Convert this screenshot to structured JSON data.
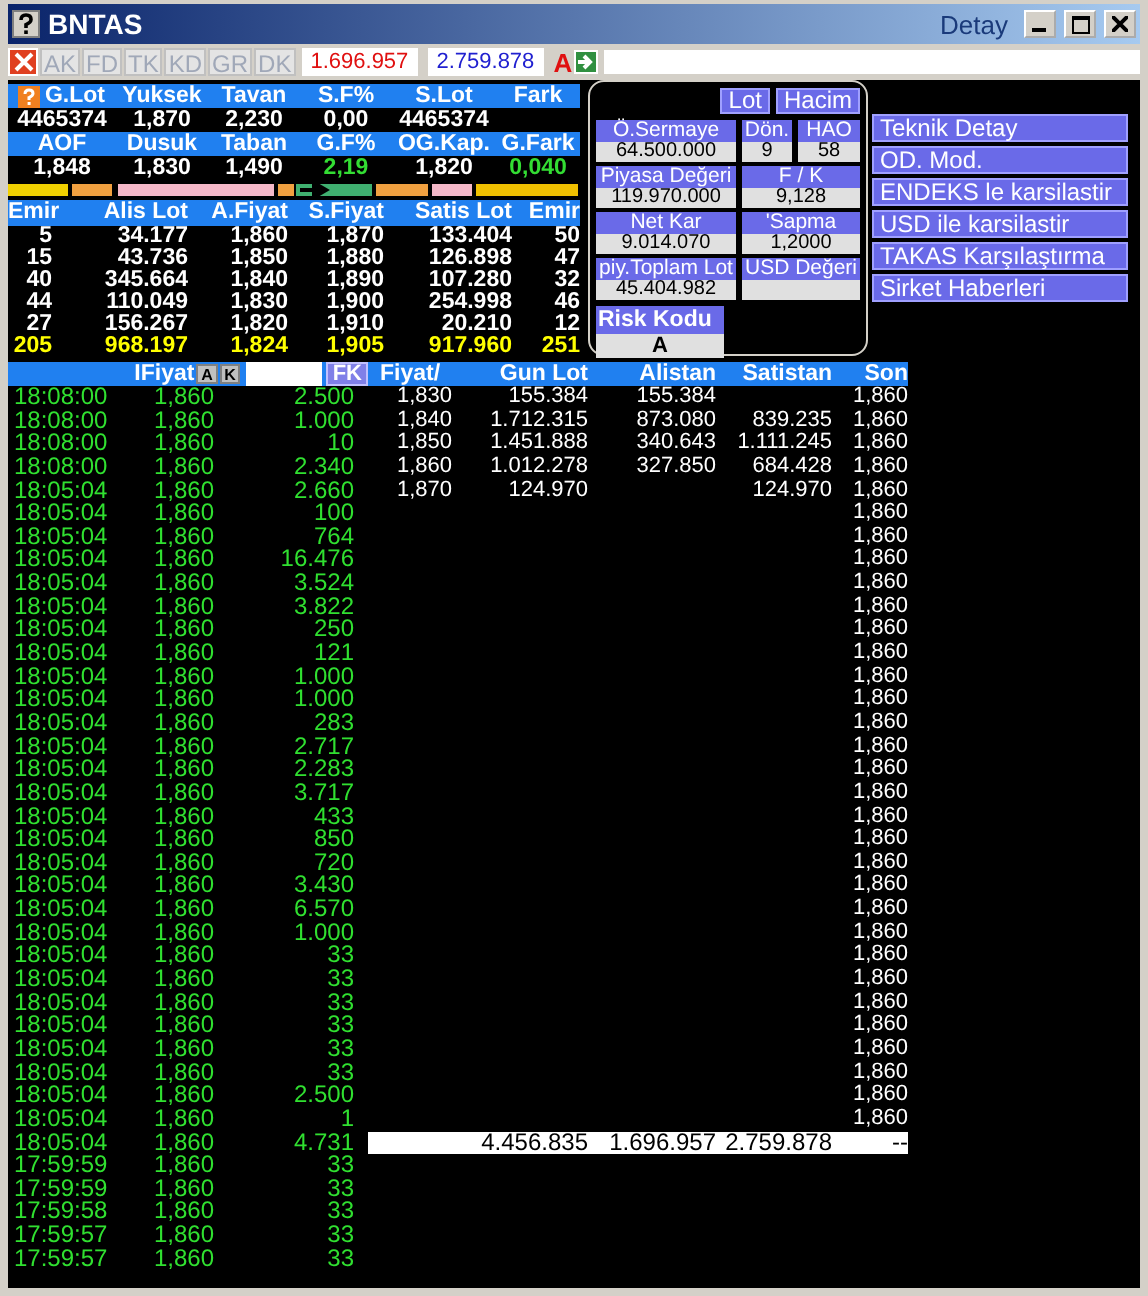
{
  "window": {
    "title": "BNTAS",
    "subtitle": "Detay"
  },
  "toolbar": {
    "buttons": [
      {
        "label": "AK",
        "disabled": true
      },
      {
        "label": "FD",
        "disabled": true
      },
      {
        "label": "TK",
        "disabled": true
      },
      {
        "label": "KD",
        "disabled": true
      },
      {
        "label": "GR",
        "disabled": true
      },
      {
        "label": "DK",
        "disabled": true
      }
    ],
    "sell_total": "1.696.957",
    "buy_total": "2.759.878",
    "flag": "A"
  },
  "stats": [
    {
      "items": [
        {
          "label": "G.Lot",
          "value": "4465374",
          "rising": false
        },
        {
          "label": "Yuksek",
          "value": "1,870",
          "rising": false
        },
        {
          "label": "Tavan",
          "value": "2,230",
          "rising": false
        },
        {
          "label": "S.F%",
          "value": "0,00",
          "rising": false
        },
        {
          "label": "S.Lot",
          "value": "4465374",
          "rising": false
        },
        {
          "label": "Fark"
        }
      ]
    },
    {
      "items": [
        {
          "label": "AOF",
          "value": "1,848",
          "rising": false
        },
        {
          "label": "Dusuk",
          "value": "1,830",
          "rising": false
        },
        {
          "label": "Taban",
          "value": "1,490",
          "rising": false
        },
        {
          "label": "G.F%",
          "value": "2,19",
          "rising": true
        },
        {
          "label": "OG.Kap.",
          "value": "1,820",
          "rising": false
        },
        {
          "label": "G.Fark",
          "value": "0,040",
          "rising": true
        }
      ]
    }
  ],
  "order_book": {
    "columns": [
      "Emir",
      "Alis Lot",
      "A.Fiyat",
      "S.Fiyat",
      "Satis Lot",
      "Emir"
    ],
    "rows": [
      [
        "5",
        "34.177",
        "1,860",
        "1,870",
        "133.404",
        "50"
      ],
      [
        "15",
        "43.736",
        "1,850",
        "1,880",
        "126.898",
        "47"
      ],
      [
        "40",
        "345.664",
        "1,840",
        "1,890",
        "107.280",
        "32"
      ],
      [
        "44",
        "110.049",
        "1,830",
        "1,900",
        "254.998",
        "46"
      ],
      [
        "27",
        "156.267",
        "1,820",
        "1,910",
        "20.210",
        "12"
      ]
    ],
    "totals": [
      "205",
      "968.197",
      "1,824",
      "1,905",
      "917.960",
      "251"
    ]
  },
  "info_panel": {
    "buttons": [
      "Lot",
      "Hacim"
    ],
    "fields": [
      {
        "label": "Ö.Sermaye",
        "value": "64.500.000"
      },
      {
        "label": "Dön.",
        "value": "9"
      },
      {
        "label": "HAO",
        "value": "58"
      },
      {
        "label": "Piyasa Değeri",
        "value": "119.970.000"
      },
      {
        "label": "F / K",
        "value": "9,128"
      },
      {
        "label": "Net Kar",
        "value": "9.014.070"
      },
      {
        "label": "'Sapma",
        "value": "1,2000"
      },
      {
        "label": "piy.Toplam Lot",
        "value": "45.404.982"
      },
      {
        "label": "USD Değeri"
      }
    ],
    "risk": {
      "label": "Risk Kodu",
      "value": "A"
    }
  },
  "links": [
    "Teknik Detay",
    "OD. Mod.",
    "ENDEKS le karsilastir",
    "USD ile karsilastir",
    "TAKAS Karşılaştırma",
    "Sirket Haberleri"
  ],
  "trades": {
    "column": "IFiyat",
    "filter_buttons": [
      "A",
      "K"
    ],
    "fk_button": "FK",
    "rows": [
      {
        "time": "18:08:00",
        "price": "1,860",
        "lot": "2.500"
      },
      {
        "time": "18:08:00",
        "price": "1,860",
        "lot": "1.000"
      },
      {
        "time": "18:08:00",
        "price": "1,860",
        "lot": "10"
      },
      {
        "time": "18:08:00",
        "price": "1,860",
        "lot": "2.340"
      },
      {
        "time": "18:05:04",
        "price": "1,860",
        "lot": "2.660"
      },
      {
        "time": "18:05:04",
        "price": "1,860",
        "lot": "100"
      },
      {
        "time": "18:05:04",
        "price": "1,860",
        "lot": "764"
      },
      {
        "time": "18:05:04",
        "price": "1,860",
        "lot": "16.476"
      },
      {
        "time": "18:05:04",
        "price": "1,860",
        "lot": "3.524"
      },
      {
        "time": "18:05:04",
        "price": "1,860",
        "lot": "3.822"
      },
      {
        "time": "18:05:04",
        "price": "1,860",
        "lot": "250"
      },
      {
        "time": "18:05:04",
        "price": "1,860",
        "lot": "121"
      },
      {
        "time": "18:05:04",
        "price": "1,860",
        "lot": "1.000"
      },
      {
        "time": "18:05:04",
        "price": "1,860",
        "lot": "1.000"
      },
      {
        "time": "18:05:04",
        "price": "1,860",
        "lot": "283"
      },
      {
        "time": "18:05:04",
        "price": "1,860",
        "lot": "2.717"
      },
      {
        "time": "18:05:04",
        "price": "1,860",
        "lot": "2.283"
      },
      {
        "time": "18:05:04",
        "price": "1,860",
        "lot": "3.717"
      },
      {
        "time": "18:05:04",
        "price": "1,860",
        "lot": "433"
      },
      {
        "time": "18:05:04",
        "price": "1,860",
        "lot": "850"
      },
      {
        "time": "18:05:04",
        "price": "1,860",
        "lot": "720"
      },
      {
        "time": "18:05:04",
        "price": "1,860",
        "lot": "3.430"
      },
      {
        "time": "18:05:04",
        "price": "1,860",
        "lot": "6.570"
      },
      {
        "time": "18:05:04",
        "price": "1,860",
        "lot": "1.000"
      },
      {
        "time": "18:05:04",
        "price": "1,860",
        "lot": "33"
      },
      {
        "time": "18:05:04",
        "price": "1,860",
        "lot": "33"
      },
      {
        "time": "18:05:04",
        "price": "1,860",
        "lot": "33"
      },
      {
        "time": "18:05:04",
        "price": "1,860",
        "lot": "33"
      },
      {
        "time": "18:05:04",
        "price": "1,860",
        "lot": "33"
      },
      {
        "time": "18:05:04",
        "price": "1,860",
        "lot": "33"
      },
      {
        "time": "18:05:04",
        "price": "1,860",
        "lot": "2.500"
      },
      {
        "time": "18:05:04",
        "price": "1,860",
        "lot": "1"
      },
      {
        "time": "18:05:04",
        "price": "1,860",
        "lot": "4.731"
      },
      {
        "time": "17:59:59",
        "price": "1,860",
        "lot": "33"
      },
      {
        "time": "17:59:59",
        "price": "1,860",
        "lot": "33"
      },
      {
        "time": "17:59:58",
        "price": "1,860",
        "lot": "33"
      },
      {
        "time": "17:59:57",
        "price": "1,860",
        "lot": "33"
      },
      {
        "time": "17:59:57",
        "price": "1,860",
        "lot": "33"
      }
    ]
  },
  "price_table": {
    "columns": [
      "Fiyat/",
      "Gun Lot",
      "Alistan",
      "Satistan",
      "Son"
    ],
    "rows": [
      {
        "fiyat": "1,830",
        "gun_lot": "155.384",
        "alistan": "155.384",
        "son": "1,860"
      },
      {
        "fiyat": "1,840",
        "gun_lot": "1.712.315",
        "alistan": "873.080",
        "satistan": "839.235",
        "son": "1,860"
      },
      {
        "fiyat": "1,850",
        "gun_lot": "1.451.888",
        "alistan": "340.643",
        "satistan": "1.111.245",
        "son": "1,860"
      },
      {
        "fiyat": "1,860",
        "gun_lot": "1.012.278",
        "alistan": "327.850",
        "satistan": "684.428",
        "son": "1,860"
      },
      {
        "fiyat": "1,870",
        "gun_lot": "124.970",
        "satistan": "124.970",
        "son": "1,860"
      },
      {
        "son": "1,860"
      },
      {
        "son": "1,860"
      },
      {
        "son": "1,860"
      },
      {
        "son": "1,860"
      },
      {
        "son": "1,860"
      },
      {
        "son": "1,860"
      },
      {
        "son": "1,860"
      },
      {
        "son": "1,860"
      },
      {
        "son": "1,860"
      },
      {
        "son": "1,860"
      },
      {
        "son": "1,860"
      },
      {
        "son": "1,860"
      },
      {
        "son": "1,860"
      },
      {
        "son": "1,860"
      },
      {
        "son": "1,860"
      },
      {
        "son": "1,860"
      },
      {
        "son": "1,860"
      },
      {
        "son": "1,860"
      },
      {
        "son": "1,860"
      },
      {
        "son": "1,860"
      },
      {
        "son": "1,860"
      },
      {
        "son": "1,860"
      },
      {
        "son": "1,860"
      },
      {
        "son": "1,860"
      },
      {
        "son": "1,860"
      },
      {
        "son": "1,860"
      },
      {
        "son": "1,860"
      }
    ],
    "total": {
      "gun_lot": "4.456.835",
      "alistan": "1.696.957",
      "satistan": "2.759.878",
      "son": "--"
    }
  }
}
